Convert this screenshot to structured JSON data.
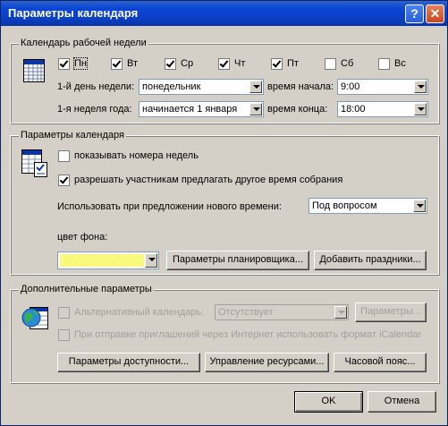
{
  "window": {
    "title": "Параметры календаря",
    "help_glyph": "?",
    "close_glyph": "✕"
  },
  "work_week": {
    "legend": "Календарь рабочей недели",
    "days": [
      {
        "label": "Пн",
        "checked": true
      },
      {
        "label": "Вт",
        "checked": true
      },
      {
        "label": "Ср",
        "checked": true
      },
      {
        "label": "Чт",
        "checked": true
      },
      {
        "label": "Пт",
        "checked": true
      },
      {
        "label": "Сб",
        "checked": false
      },
      {
        "label": "Вс",
        "checked": false
      }
    ],
    "first_day_label": "1-й день недели:",
    "first_day_value": "понедельник",
    "start_time_label": "время начала:",
    "start_time_value": "9:00",
    "first_week_label": "1-я неделя года:",
    "first_week_value": "начинается 1 января",
    "end_time_label": "время конца:",
    "end_time_value": "18:00"
  },
  "calendar_options": {
    "legend": "Параметры календаря",
    "show_week_numbers": {
      "label": "показывать номера недель",
      "checked": false
    },
    "allow_propose": {
      "label": "разрешать участникам предлагать другое время собрания",
      "checked": true
    },
    "propose_use_label": "Использовать при предложении нового времени:",
    "propose_use_value": "Под вопросом",
    "bg_color_label": "цвет фона:",
    "bg_color": "#ffff80",
    "scheduler_button": "Параметры планировщика...",
    "holidays_button": "Добавить праздники..."
  },
  "advanced": {
    "legend": "Дополнительные параметры",
    "alt_calendar_label": "Альтернативный календарь:",
    "alt_calendar_value": "Отсутствует",
    "alt_params_button": "Параметры...",
    "icalendar_label": "При отправке приглашений через Интернет использовать формат iCalendar",
    "availability_button": "Параметры доступности...",
    "resources_button": "Управление ресурсами...",
    "timezone_button": "Часовой пояс..."
  },
  "footer": {
    "ok": "OK",
    "cancel": "Отмена"
  }
}
